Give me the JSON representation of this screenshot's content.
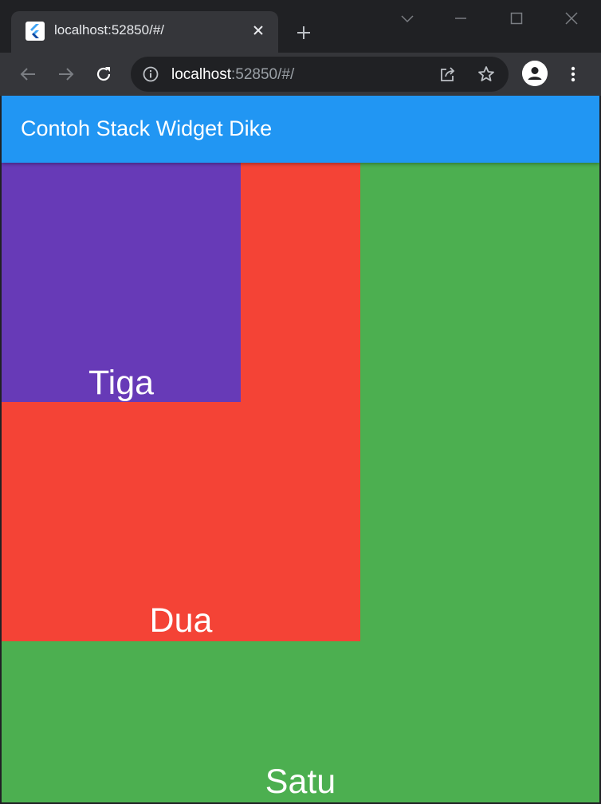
{
  "browser": {
    "tab_title": "localhost:52850/#/",
    "url_host": "localhost",
    "url_rest": ":52850/#/",
    "icons": {
      "favicon": "flutter-icon",
      "tab_close": "close-icon",
      "new_tab": "plus-icon",
      "tab_search": "chevron-down-icon",
      "minimize": "minimize-icon",
      "maximize": "maximize-icon",
      "close_window": "close-icon",
      "back": "back-arrow-icon",
      "forward": "forward-arrow-icon",
      "reload": "reload-icon",
      "site_info": "info-icon",
      "share": "share-icon",
      "bookmark": "star-icon",
      "profile": "avatar-icon",
      "menu": "kebab-menu-icon"
    }
  },
  "app": {
    "title": "Contoh Stack Widget Dike",
    "boxes": [
      {
        "label": "Satu",
        "color": "#4caf50"
      },
      {
        "label": "Dua",
        "color": "#f44336"
      },
      {
        "label": "Tiga",
        "color": "#673ab7"
      }
    ],
    "appbar_color": "#2196f3"
  }
}
